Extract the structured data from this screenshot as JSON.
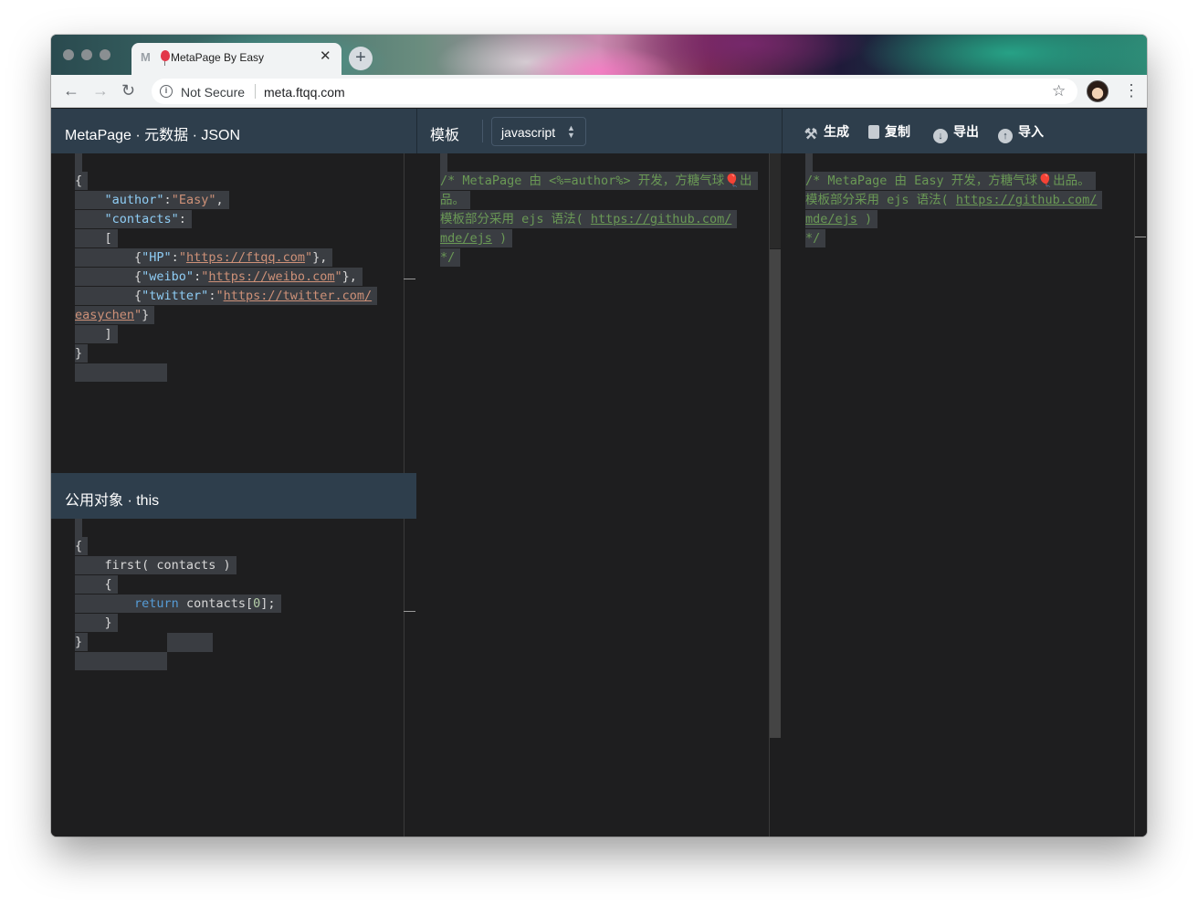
{
  "browser": {
    "tab_title": "MetaPage By Easy",
    "tab_close": "✕",
    "new_tab": "+",
    "security": "Not Secure",
    "url": "meta.ftqq.com"
  },
  "app": {
    "json_title": "MetaPage · 元数据 · JSON",
    "template_title": "模板",
    "language": "javascript",
    "actions": {
      "generate": "生成",
      "copy": "复制",
      "export": "导出",
      "import": "导入"
    },
    "this_title": "公用对象 · this"
  },
  "json_editor": {
    "lines": [
      "{",
      "    \"author\":\"Easy\",",
      "    \"contacts\":",
      "    [",
      "        {\"HP\":\"https://ftqq.com\"},",
      "        {\"weibo\":\"https://weibo.com\"},",
      "        {\"twitter\":\"https://twitter.com/",
      "easychen\"}",
      "    ]",
      "}"
    ]
  },
  "this_editor": {
    "lines": [
      "{",
      "    first( contacts )",
      "    {",
      "        return contacts[0];",
      "    }",
      "}"
    ]
  },
  "template_editor": {
    "line1": "/* MetaPage 由 <%=author%> 开发，方糖气球🎈出",
    "line2": "品。",
    "line3_prefix": "模板部分采用 ejs 语法( ",
    "line3_url": "https://github.com/",
    "line4_url": "mde/ejs",
    "line4_suffix": " )",
    "line5": "*/"
  },
  "output_editor": {
    "line1": "/* MetaPage 由 Easy 开发，方糖气球🎈出品。",
    "line2_prefix": "模板部分采用 ejs 语法( ",
    "line2_url": "https://github.com/",
    "line3_url": "mde/ejs",
    "line3_suffix": " )",
    "line4": "*/"
  },
  "colors": {
    "panel_header": "#2e3e4c",
    "editor_bg": "#1e1e1f",
    "json_key": "#8fcdf5",
    "json_string": "#ce9178",
    "comment": "#6a9955"
  },
  "icons": [
    "hammer-icon",
    "clipboard-icon",
    "download-icon",
    "upload-icon",
    "info-icon",
    "star-icon",
    "kebab-menu-icon"
  ]
}
